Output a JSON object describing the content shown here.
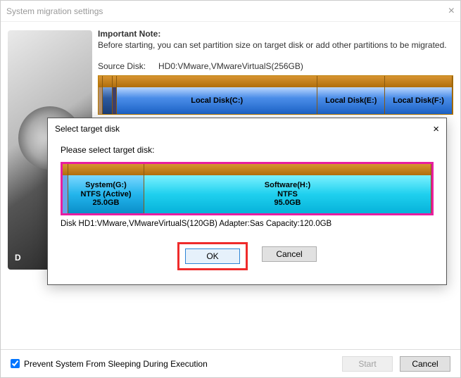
{
  "window": {
    "title": "System migration settings",
    "close_glyph": "×"
  },
  "note": {
    "title": "Important Note:",
    "text": "Before starting, you can set partition size on target disk or add other partitions to be migrated."
  },
  "source": {
    "label": "Source Disk:",
    "value": "HD0:VMware,VMwareVirtualS(256GB)",
    "partitions": {
      "c": "Local Disk(C:)",
      "e": "Local Disk(E:)",
      "f": "Local Disk(F:)"
    }
  },
  "hdd_label": "D",
  "footer": {
    "checkbox_label": "Prevent System From Sleeping During Execution",
    "checked": true,
    "start": "Start",
    "cancel": "Cancel"
  },
  "modal": {
    "title": "Select target disk",
    "close_glyph": "×",
    "prompt": "Please select target disk:",
    "g": {
      "name": "System(G:)",
      "fs": "NTFS (Active)",
      "size": "25.0GB"
    },
    "h": {
      "name": "Software(H:)",
      "fs": "NTFS",
      "size": "95.0GB"
    },
    "diskinfo": "Disk HD1:VMware,VMwareVirtualS(120GB)  Adapter:Sas  Capacity:120.0GB",
    "ok": "OK",
    "cancel": "Cancel"
  }
}
